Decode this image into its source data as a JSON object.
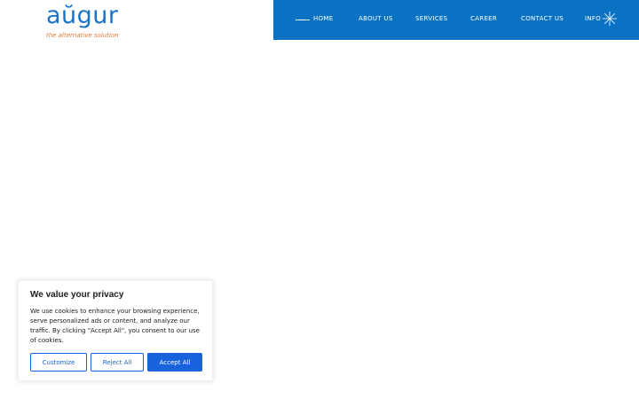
{
  "brand": {
    "logo_text": "aŭgur",
    "tagline": "the alternative solution",
    "logo_color": "#1a73c6",
    "tagline_color": "#e07b3a"
  },
  "nav": {
    "background": "#0a72c3",
    "items": [
      {
        "label": "HOME"
      },
      {
        "label": "ABOUT US"
      },
      {
        "label": "SERVICES"
      },
      {
        "label": "CAREER"
      },
      {
        "label": "CONTACT US"
      },
      {
        "label": "INFO"
      }
    ],
    "info_icon": "asterisk-star-icon"
  },
  "cookie_banner": {
    "title": "We value your privacy",
    "body": "We use cookies to enhance your browsing experience, serve personalized ads or content, and analyze our traffic. By clicking \"Accept All\", you consent to our use of cookies.",
    "buttons": {
      "customize": "Customize",
      "reject": "Reject All",
      "accept": "Accept All"
    },
    "accent": "#1863dc"
  }
}
